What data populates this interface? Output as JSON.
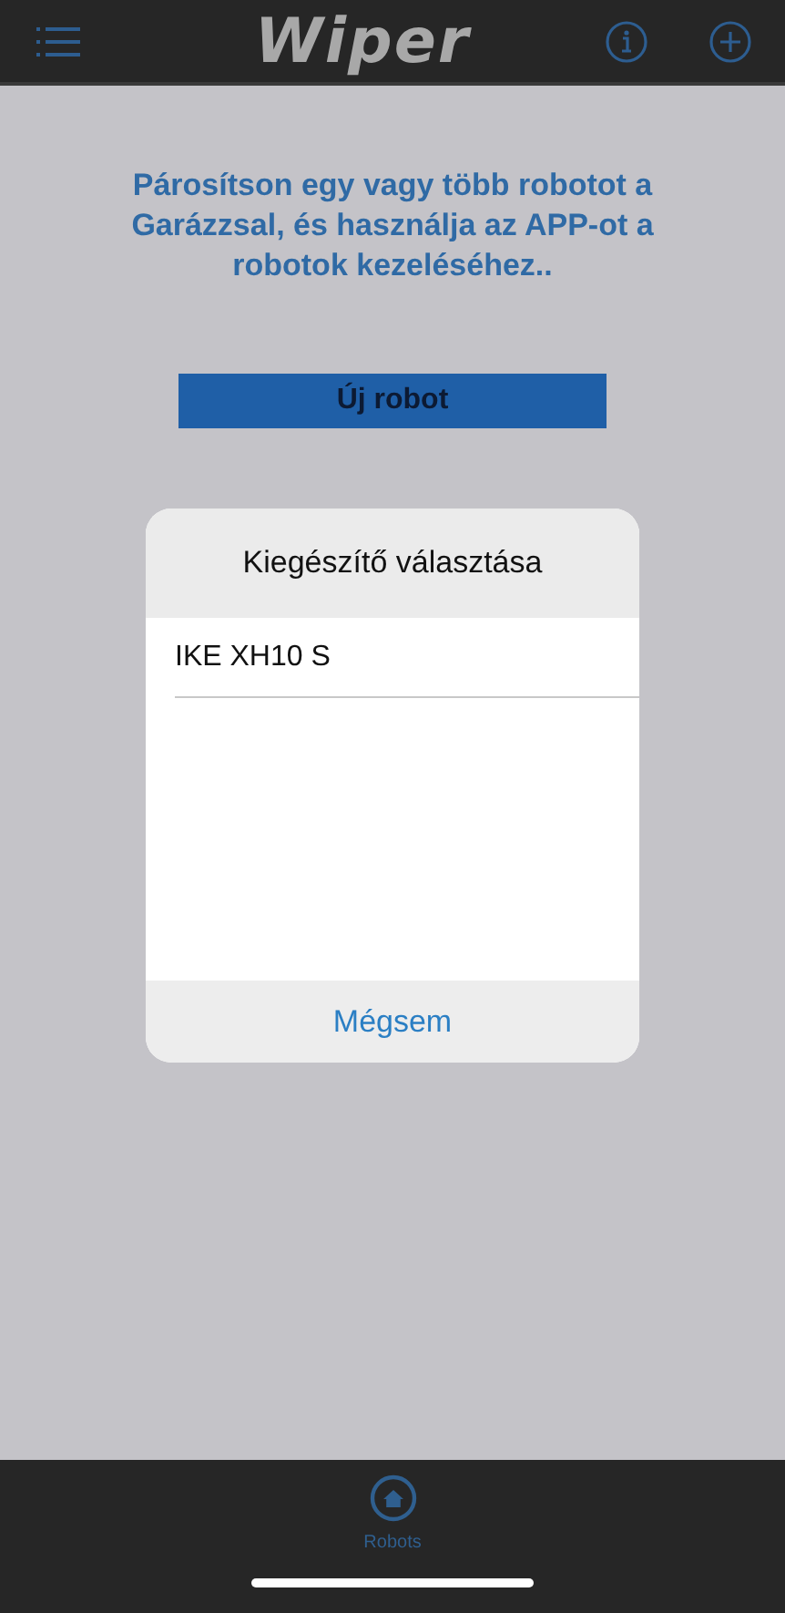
{
  "header": {
    "logo": "Wiper"
  },
  "message": "Párosítson egy vagy több robotot a Garázzsal, és használja az APP-ot a robotok kezeléséhez..",
  "new_robot_button": "Új robot",
  "dialog": {
    "title": "Kiegészítő választása",
    "items": [
      {
        "label": "IKE XH10 S"
      }
    ],
    "cancel": "Mégsem"
  },
  "tab_bar": {
    "tabs": [
      {
        "label": "Robots",
        "selected": true
      }
    ]
  }
}
